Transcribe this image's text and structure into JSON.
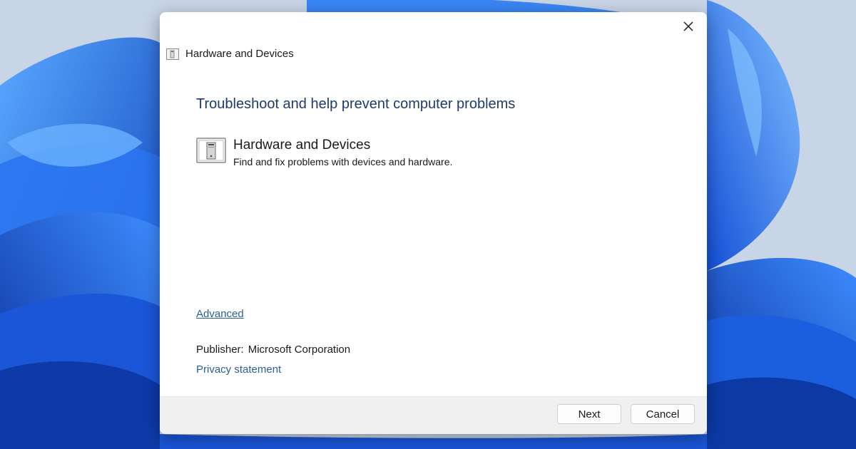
{
  "window": {
    "title": "Hardware and Devices",
    "close_icon": "close-icon",
    "title_icon": "troubleshooter-icon"
  },
  "main": {
    "heading": "Troubleshoot and help prevent computer problems",
    "item": {
      "title": "Hardware and Devices",
      "description": "Find and fix problems with devices and hardware.",
      "icon": "hardware-device-icon"
    },
    "advanced_label": "Advanced",
    "publisher_label": "Publisher:",
    "publisher_value": "Microsoft Corporation",
    "privacy_label": "Privacy statement"
  },
  "footer": {
    "next_label": "Next",
    "cancel_label": "Cancel"
  },
  "colors": {
    "heading": "#1e3a6e",
    "link": "#2a6099",
    "wallpaper_blue": "#1f6fe0"
  }
}
